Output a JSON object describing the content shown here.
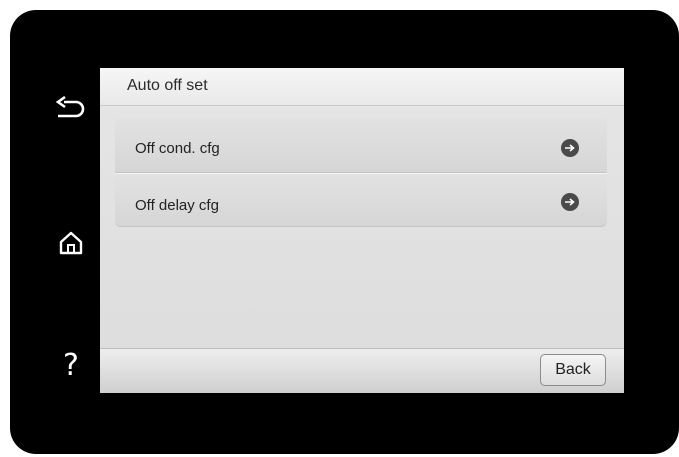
{
  "side_panel": {
    "back_icon": "back-arrow-icon",
    "home_icon": "home-icon",
    "help_icon": "help-icon",
    "help_glyph": "?"
  },
  "screen": {
    "title": "Auto off set",
    "menu_items": [
      {
        "label": "Off cond. cfg",
        "icon": "arrow-right-circle-icon"
      },
      {
        "label": "Off delay cfg",
        "icon": "arrow-right-circle-icon"
      }
    ],
    "back_button_label": "Back"
  },
  "colors": {
    "bezel": "#000000",
    "screen_bg": "#e0e0e0",
    "icon_dark": "#4a4a4a"
  }
}
